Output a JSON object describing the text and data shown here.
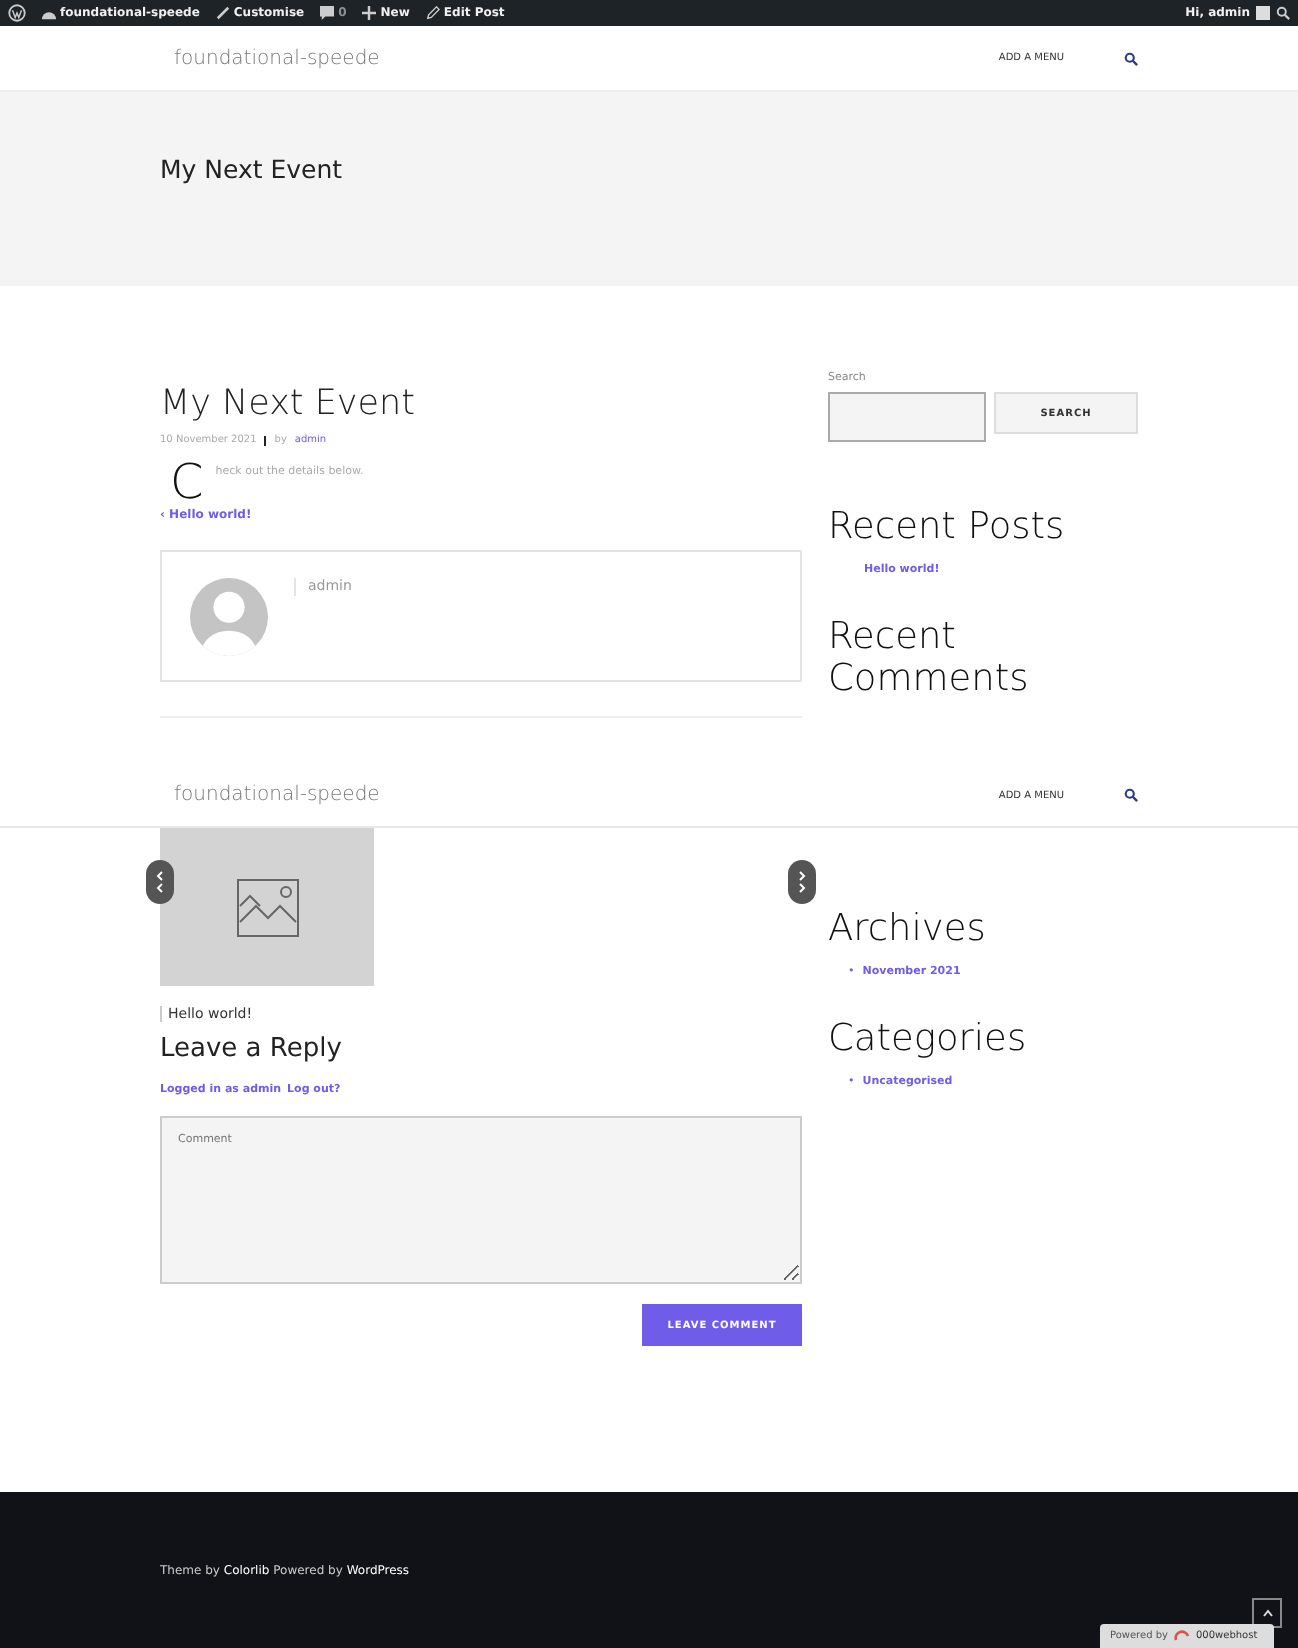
{
  "admin_bar": {
    "items": [
      {
        "kind": "logo"
      },
      {
        "kind": "site",
        "label": "foundational-speede"
      },
      {
        "kind": "customise",
        "label": "Customise"
      },
      {
        "kind": "comments",
        "label": "0"
      },
      {
        "kind": "new",
        "label": "New"
      },
      {
        "kind": "edit",
        "label": "Edit Post"
      }
    ],
    "greeting": "Hi, admin"
  },
  "header": {
    "site_title": "foundational-speede",
    "menu": "ADD A MENU"
  },
  "page_banner": {
    "title": "My Next Event"
  },
  "post": {
    "title": "My Next Event",
    "date": "10 November 2021",
    "by": "by",
    "author": "admin",
    "drop_cap": "C",
    "body": "heck out the details below.",
    "prev_link": "‹ Hello world!",
    "author_box": {
      "name": "admin"
    }
  },
  "sticky_header": {
    "site_title": "foundational-speede",
    "menu": "ADD A MENU"
  },
  "related_posts": [
    {
      "title": "Hello world!"
    }
  ],
  "reply": {
    "title": "Leave a Reply",
    "logged_in": "Logged in as admin",
    "logout": "Log out?",
    "comment_placeholder": "Comment",
    "submit": "LEAVE COMMENT"
  },
  "sidebar_top": {
    "search_label": "Search",
    "search_button": "SEARCH",
    "widgets": [
      {
        "title": "Recent Posts",
        "items": [
          "Hello world!"
        ]
      },
      {
        "title": "Recent Comments"
      }
    ]
  },
  "sidebar_bottom": {
    "widgets": [
      {
        "title": "Archives",
        "items": [
          {
            "marker": "•",
            "label": "November 2021"
          }
        ]
      },
      {
        "title": "Categories",
        "items": [
          {
            "marker": "•",
            "label": "Uncategorised"
          }
        ]
      }
    ]
  },
  "footer": {
    "theme_by": "Theme by",
    "colorlib": "Colorlib",
    "powered_by": "Powered by",
    "wordpress": "WordPress"
  },
  "hosting_badge": {
    "prefix": "Powered by",
    "name": "000webhost"
  }
}
